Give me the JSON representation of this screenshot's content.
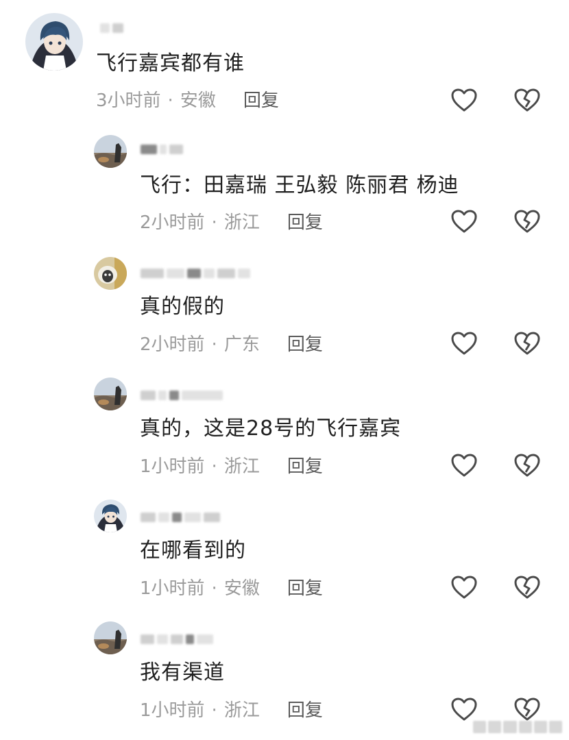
{
  "comments": [
    {
      "text": "飞行嘉宾都有谁",
      "time": "3小时前",
      "dot": "·",
      "location": "安徽",
      "reply": "回复"
    },
    {
      "text": "飞行：田嘉瑞 王弘毅  陈丽君 杨迪",
      "time": "2小时前",
      "dot": "·",
      "location": "浙江",
      "reply": "回复"
    },
    {
      "text": "真的假的",
      "time": "2小时前",
      "dot": "·",
      "location": "广东",
      "reply": "回复"
    },
    {
      "text": "真的，这是28号的飞行嘉宾",
      "time": "1小时前",
      "dot": "·",
      "location": "浙江",
      "reply": "回复"
    },
    {
      "text": "在哪看到的",
      "time": "1小时前",
      "dot": "·",
      "location": "安徽",
      "reply": "回复"
    },
    {
      "text": "我有渠道",
      "time": "1小时前",
      "dot": "·",
      "location": "浙江",
      "reply": "回复"
    }
  ],
  "icons": {
    "like": "heart-outline-icon",
    "dislike": "broken-heart-icon"
  },
  "colors": {
    "text": "#1f1f1f",
    "meta": "#9a9a9a",
    "reply": "#5a5a5a",
    "icon": "#4a4a4a"
  }
}
